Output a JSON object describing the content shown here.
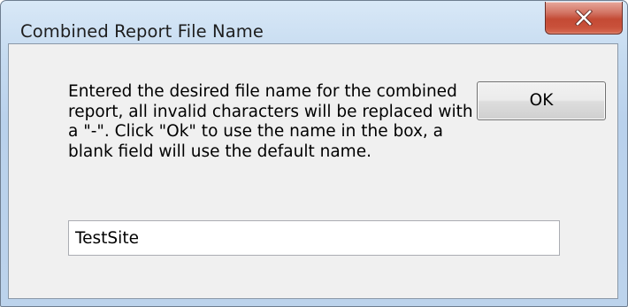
{
  "window": {
    "title": "Combined Report File Name"
  },
  "dialog": {
    "message": "Entered the desired file name for the combined report, all invalid characters will be replaced with a \"-\".  Click \"Ok\" to use the name in the box, a blank field will use the default name.",
    "ok_label": "OK",
    "file_name_value": "TestSite"
  },
  "icons": {
    "close": "close-icon"
  },
  "colors": {
    "close_button": "#c44a34",
    "title_bar": "#c6dbf0",
    "client_background": "#f0f0f0"
  }
}
